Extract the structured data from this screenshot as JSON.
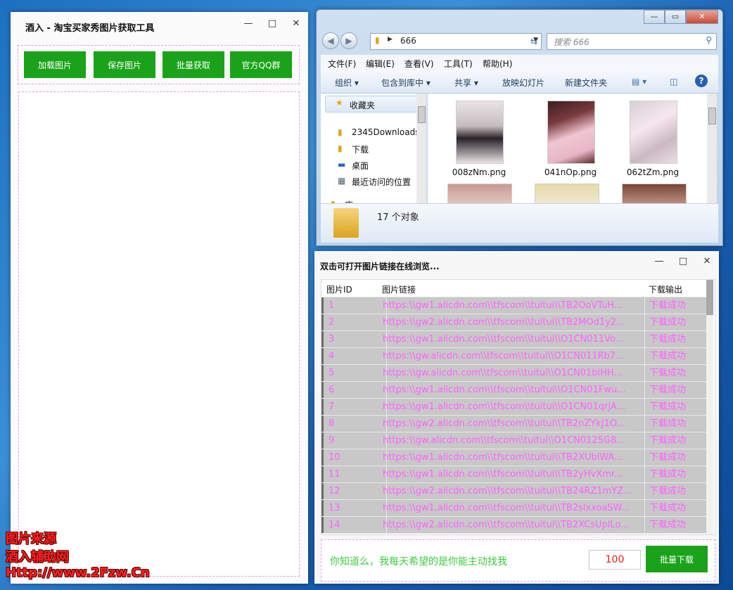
{
  "left_app": {
    "title": "酒入 - 淘宝买家秀图片获取工具",
    "buttons": [
      "加载图片",
      "保存图片",
      "批量获取",
      "官方QQ群"
    ],
    "controls": {
      "minimize": "—",
      "maximize": "□",
      "close": "✕"
    }
  },
  "explorer": {
    "address": "666",
    "search_placeholder": "搜索 666",
    "menu": [
      "文件(F)",
      "编辑(E)",
      "查看(V)",
      "工具(T)",
      "帮助(H)"
    ],
    "toolbar": [
      "组织 ▾",
      "包含到库中 ▾",
      "共享 ▾",
      "放映幻灯片",
      "新建文件夹"
    ],
    "nav_items": [
      {
        "label": "收藏夹",
        "icon": "star-icon"
      },
      {
        "label": "2345Downloads",
        "icon": "folder-icon"
      },
      {
        "label": "下载",
        "icon": "download-folder-icon"
      },
      {
        "label": "桌面",
        "icon": "desktop-icon"
      },
      {
        "label": "最近访问的位置",
        "icon": "recent-places-icon"
      },
      {
        "label": "库",
        "icon": "library-icon"
      }
    ],
    "files": [
      "008zNm.png",
      "041nOp.png",
      "062tZm.png"
    ],
    "status": "17 个对象"
  },
  "right_app": {
    "title": "双击可打开图片链接在线浏览...",
    "controls": {
      "minimize": "—",
      "maximize": "□",
      "close": "✕"
    },
    "columns": [
      "图片ID",
      "图片链接",
      "下载输出"
    ],
    "rows": [
      {
        "id": "1",
        "url": "https:\\\\gw1.alicdn.com\\\\tfscom\\\\tuitui\\\\TB2OoVTuH...",
        "out": "下载成功"
      },
      {
        "id": "2",
        "url": "https:\\\\gw2.alicdn.com\\\\tfscom\\\\tuitui\\\\TB2MOd1y2...",
        "out": "下载成功"
      },
      {
        "id": "3",
        "url": "https:\\\\gw1.alicdn.com\\\\tfscom\\\\tuitui\\\\O1CN011Vo...",
        "out": "下载成功"
      },
      {
        "id": "4",
        "url": "https:\\\\gw.alicdn.com\\\\tfscom\\\\tuitui\\\\O1CN011Rb7...",
        "out": "下载成功"
      },
      {
        "id": "5",
        "url": "https:\\\\gw.alicdn.com\\\\tfscom\\\\tuitui\\\\O1CN01blHH...",
        "out": "下载成功"
      },
      {
        "id": "6",
        "url": "https:\\\\gw1.alicdn.com\\\\tfscom\\\\tuitui\\\\O1CN01Fwu...",
        "out": "下载成功"
      },
      {
        "id": "7",
        "url": "https:\\\\gw1.alicdn.com\\\\tfscom\\\\tuitui\\\\O1CN01qrjA...",
        "out": "下载成功"
      },
      {
        "id": "8",
        "url": "https:\\\\gw2.alicdn.com\\\\tfscom\\\\tuitui\\\\TB2nZYkJ1O...",
        "out": "下载成功"
      },
      {
        "id": "9",
        "url": "https:\\\\gw.alicdn.com\\\\tfscom\\\\tuitui\\\\O1CN0125G8...",
        "out": "下载成功"
      },
      {
        "id": "10",
        "url": "https:\\\\gw1.alicdn.com\\\\tfscom\\\\tuitui\\\\TB2XUblWA...",
        "out": "下载成功"
      },
      {
        "id": "11",
        "url": "https:\\\\gw1.alicdn.com\\\\tfscom\\\\tuitui\\\\TB2yHvXmr...",
        "out": "下载成功"
      },
      {
        "id": "12",
        "url": "https:\\\\gw2.alicdn.com\\\\tfscom\\\\tuitui\\\\TB24RZ1mYZ...",
        "out": "下载成功"
      },
      {
        "id": "13",
        "url": "https:\\\\gw1.alicdn.com\\\\tfscom\\\\tuitui\\\\TB2slxxoaSW...",
        "out": "下载成功"
      },
      {
        "id": "14",
        "url": "https:\\\\gw2.alicdn.com\\\\tfscom\\\\tuitui\\\\TB2XCsUplLo...",
        "out": "下载成功"
      }
    ],
    "tip": "你知道么，我每天希望的是你能主动找我",
    "count": "100",
    "download_button": "批量下载"
  },
  "watermark": [
    "图片来源",
    "酒入辅助网",
    "Http://www.2Fzw.Cn"
  ],
  "colors": {
    "accent_green": "#1aa31a",
    "link_pink": "#ff62ff",
    "watermark_red": "#ff2020"
  }
}
